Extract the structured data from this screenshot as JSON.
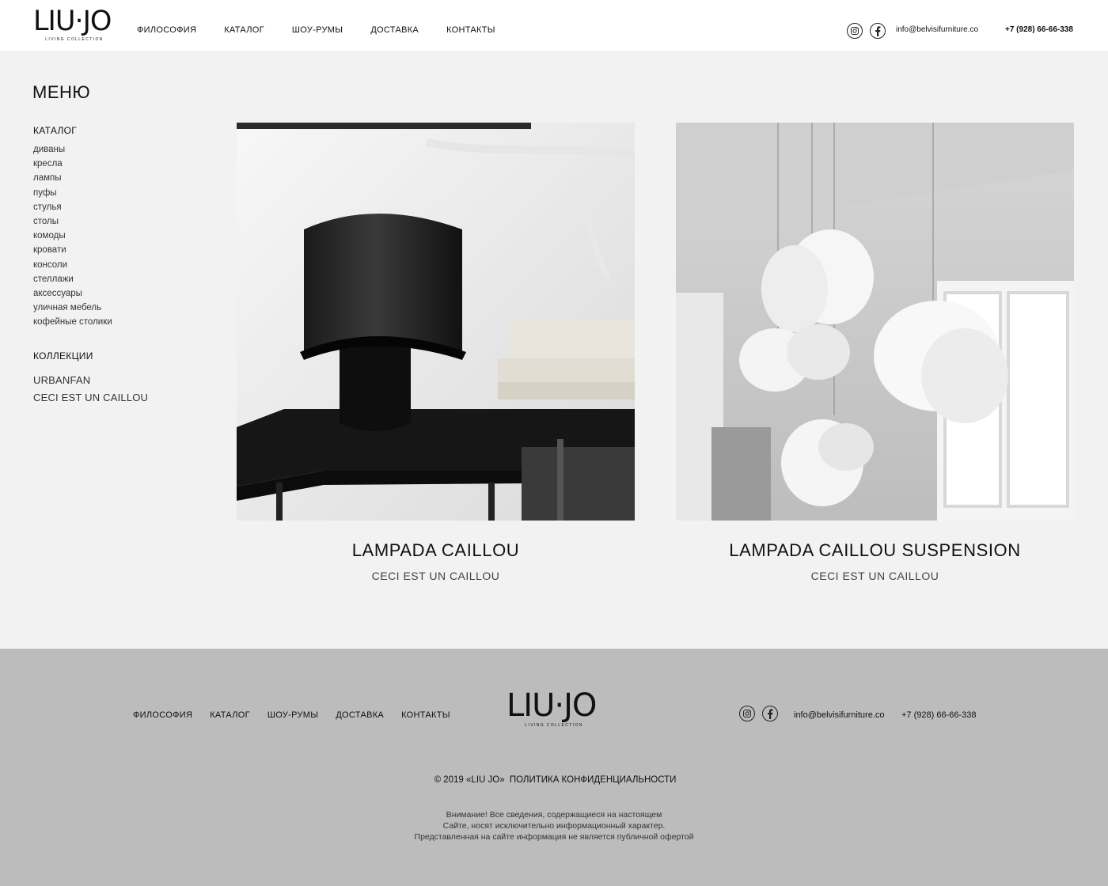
{
  "brand": {
    "name": "LIU·JO",
    "tagline": "LIVING COLLECTION"
  },
  "header": {
    "nav": [
      "ФИЛОСОФИЯ",
      "КАТАЛОГ",
      "ШОУ-РУМЫ",
      "ДОСТАВКА",
      "КОНТАКТЫ"
    ],
    "icons": [
      "instagram-icon",
      "facebook-icon"
    ],
    "email": "info@belvisifurniture.co",
    "phone": "+7 (928) 66-66-338"
  },
  "sidebar": {
    "title": "МЕНЮ",
    "catalog_heading": "КАТАЛОГ",
    "catalog_items": [
      "диваны",
      "кресла",
      "лампы",
      "пуфы",
      "стулья",
      "столы",
      "комоды",
      "кровати",
      "консоли",
      "стеллажи",
      "аксессуары",
      "уличная мебель",
      "кофейные столики"
    ],
    "collections_heading": "КОЛЛЕКЦИИ",
    "collection_items": [
      "URBANFAN",
      "CECI EST UN CAILLOU"
    ]
  },
  "products": [
    {
      "title": "LAMPADA CAILLOU",
      "collection": "CECI EST UN CAILLOU"
    },
    {
      "title": "LAMPADA CAILLOU SUSPENSION",
      "collection": "CECI EST UN CAILLOU"
    }
  ],
  "footer": {
    "nav": [
      "ФИЛОСОФИЯ",
      "КАТАЛОГ",
      "ШОУ-РУМЫ",
      "ДОСТАВКА",
      "КОНТАКТЫ"
    ],
    "email": "info@belvisifurniture.co",
    "phone": "+7 (928) 66-66-338",
    "copyright": "© 2019 «LIU JO»",
    "privacy": "ПОЛИТИКА КОНФИДЕНЦИАЛЬНОСТИ",
    "disclaimer": [
      "Внимание! Все сведения, содержащиеся на настоящем",
      "Сайте, носят исключительно информационный характер.",
      "Представленная на сайте информация не является публичной офертой"
    ]
  },
  "colors": {
    "header_bg": "#ffffff",
    "page_bg": "#f2f2f2",
    "footer_bg": "#bcbcbc",
    "text": "#111111"
  }
}
